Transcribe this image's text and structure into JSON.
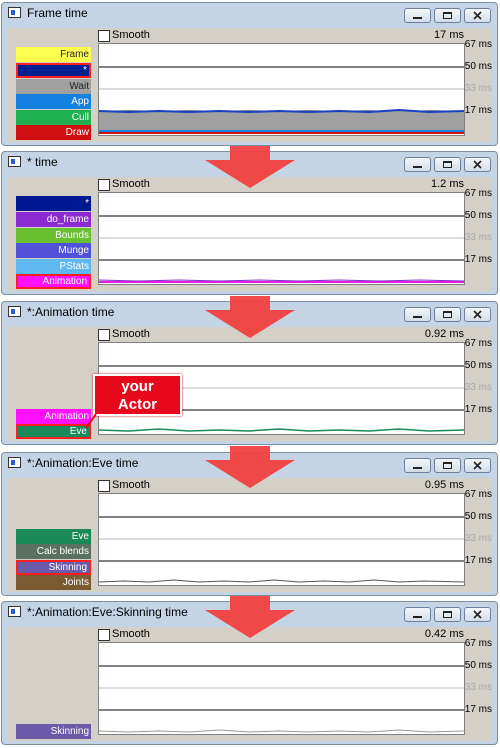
{
  "windows": [
    {
      "title": "Frame time",
      "smooth_label": "Smooth",
      "value": "17 ms",
      "ticks": [
        "67 ms",
        "50 ms",
        "33 ms",
        "17 ms"
      ],
      "legend": [
        {
          "label": "Frame",
          "color": "#ffff50",
          "dark": true
        },
        {
          "label": "*",
          "color": "#002090",
          "highlight": true
        },
        {
          "label": "Wait",
          "color": "#a0a0a0",
          "dark": true
        },
        {
          "label": "App",
          "color": "#1480e0"
        },
        {
          "label": "Cull",
          "color": "#20b050"
        },
        {
          "label": "Draw",
          "color": "#d01010"
        }
      ]
    },
    {
      "title": "* time",
      "smooth_label": "Smooth",
      "value": "1.2 ms",
      "ticks": [
        "67 ms",
        "50 ms",
        "33 ms",
        "17 ms"
      ],
      "legend": [
        {
          "label": "*",
          "color": "#001890"
        },
        {
          "label": "do_frame",
          "color": "#8a2ad0"
        },
        {
          "label": "Bounds",
          "color": "#68c030"
        },
        {
          "label": "Munge",
          "color": "#5050d8"
        },
        {
          "label": "PStats",
          "color": "#60b8f0"
        },
        {
          "label": "Animation",
          "color": "#ff10ff",
          "highlight": true
        }
      ]
    },
    {
      "title": "*:Animation time",
      "smooth_label": "Smooth",
      "value": "0.92 ms",
      "ticks": [
        "67 ms",
        "50 ms",
        "33 ms",
        "17 ms"
      ],
      "legend": [
        {
          "label": "Animation",
          "color": "#ff10ff"
        },
        {
          "label": "Eve",
          "color": "#1a8a5a",
          "highlight": true
        }
      ]
    },
    {
      "title": "*:Animation:Eve time",
      "smooth_label": "Smooth",
      "value": "0.95 ms",
      "ticks": [
        "67 ms",
        "50 ms",
        "33 ms",
        "17 ms"
      ],
      "legend": [
        {
          "label": "Eve",
          "color": "#1a8a5a"
        },
        {
          "label": "Calc blends",
          "color": "#5a7060"
        },
        {
          "label": "Skinning",
          "color": "#6a5aa8",
          "highlight": true
        },
        {
          "label": "Joints",
          "color": "#7a5a30"
        }
      ]
    },
    {
      "title": "*:Animation:Eve:Skinning time",
      "smooth_label": "Smooth",
      "value": "0.42 ms",
      "ticks": [
        "67 ms",
        "50 ms",
        "33 ms",
        "17 ms"
      ],
      "legend": [
        {
          "label": "Skinning",
          "color": "#6a5aa8"
        }
      ]
    }
  ],
  "callout": {
    "line1": "your",
    "line2": "Actor"
  },
  "colors": {
    "arrow": "#f04040",
    "callout": "#e8081c"
  }
}
